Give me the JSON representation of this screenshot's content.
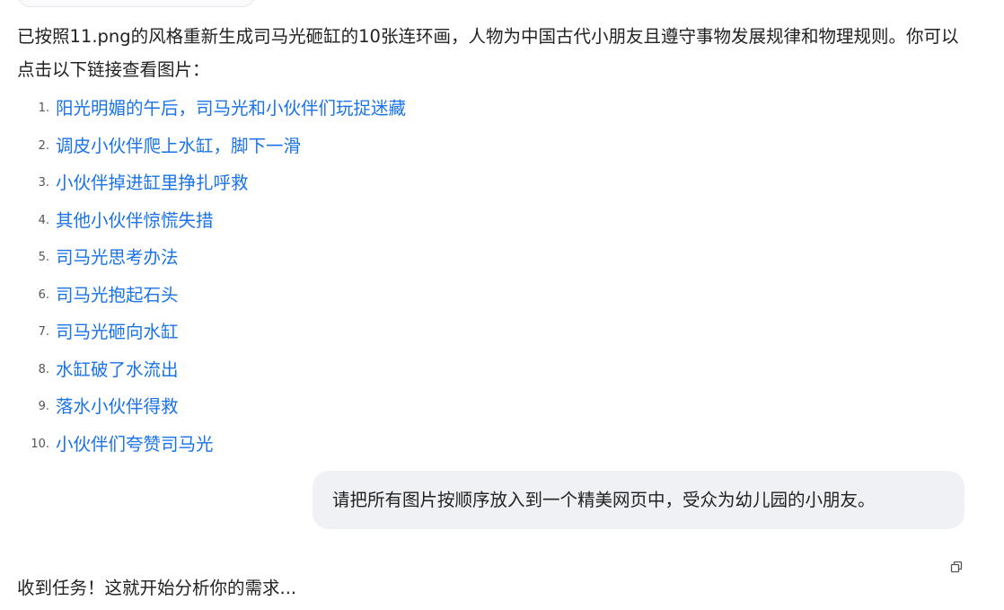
{
  "assistant_message": {
    "intro": "已按照11.png的风格重新生成司马光砸缸的10张连环画，人物为中国古代小朋友且遵守事物发展规律和物理规则。你可以点击以下链接查看图片：",
    "links": [
      {
        "num": "1.",
        "label": "阳光明媚的午后，司马光和小伙伴们玩捉迷藏"
      },
      {
        "num": "2.",
        "label": "调皮小伙伴爬上水缸，脚下一滑"
      },
      {
        "num": "3.",
        "label": "小伙伴掉进缸里挣扎呼救"
      },
      {
        "num": "4.",
        "label": "其他小伙伴惊慌失措"
      },
      {
        "num": "5.",
        "label": "司马光思考办法"
      },
      {
        "num": "6.",
        "label": "司马光抱起石头"
      },
      {
        "num": "7.",
        "label": "司马光砸向水缸"
      },
      {
        "num": "8.",
        "label": "水缸破了水流出"
      },
      {
        "num": "9.",
        "label": "落水小伙伴得救"
      },
      {
        "num": "10.",
        "label": "小伙伴们夸赞司马光"
      }
    ]
  },
  "user_message": {
    "text": "请把所有图片按顺序放入到一个精美网页中，受众为幼儿园的小朋友。"
  },
  "assistant_reply": {
    "text": "收到任务！这就开始分析你的需求..."
  },
  "icons": {
    "copy": "copy-icon"
  },
  "colors": {
    "link": "#1a73e8",
    "user_bubble_bg": "#eff1f5",
    "text": "#222222"
  }
}
